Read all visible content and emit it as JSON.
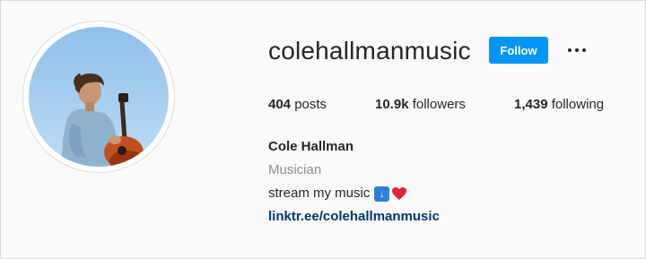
{
  "profile": {
    "username": "colehallmanmusic",
    "follow_label": "Follow",
    "more_icon": "more-horizontal-icon",
    "avatar_icon": "profile-photo"
  },
  "stats": {
    "posts_count": "404",
    "posts_label": "posts",
    "followers_count": "10.9k",
    "followers_label": "followers",
    "following_count": "1,439",
    "following_label": "following"
  },
  "bio": {
    "name": "Cole Hallman",
    "category": "Musician",
    "text": "stream my music",
    "emoji_1": "down-arrow-emoji",
    "emoji_2": "red-heart-emoji",
    "link": "linktr.ee/colehallmanmusic"
  },
  "colors": {
    "follow_button": "#0095f6",
    "link": "#00376b",
    "category": "#8e8e8e",
    "background": "#fafafa"
  }
}
